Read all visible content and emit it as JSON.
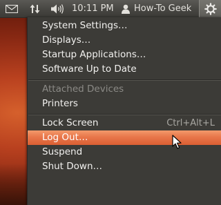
{
  "panel": {
    "icons": {
      "mail": "mail-envelope-icon",
      "network": "network-updown-icon",
      "volume": "speaker-volume-icon",
      "user": "user-person-icon",
      "session": "power-gear-icon"
    },
    "clock": "10:11 PM",
    "user_name": "How-To Geek"
  },
  "menu": {
    "items": [
      {
        "label": "System Settings…"
      },
      {
        "label": "Displays…"
      },
      {
        "label": "Startup Applications…"
      },
      {
        "label": "Software Up to Date"
      },
      {
        "label": "Attached Devices"
      },
      {
        "label": "Printers"
      },
      {
        "label": "Lock Screen",
        "shortcut": "Ctrl+Alt+L"
      },
      {
        "label": "Log Out…"
      },
      {
        "label": "Suspend"
      },
      {
        "label": "Shut Down…"
      }
    ]
  },
  "colors": {
    "panel_bg": "#3c3b37",
    "menu_bg": "#3c3b37",
    "highlight": "#e8764a",
    "disabled_text": "#8b8a86"
  }
}
